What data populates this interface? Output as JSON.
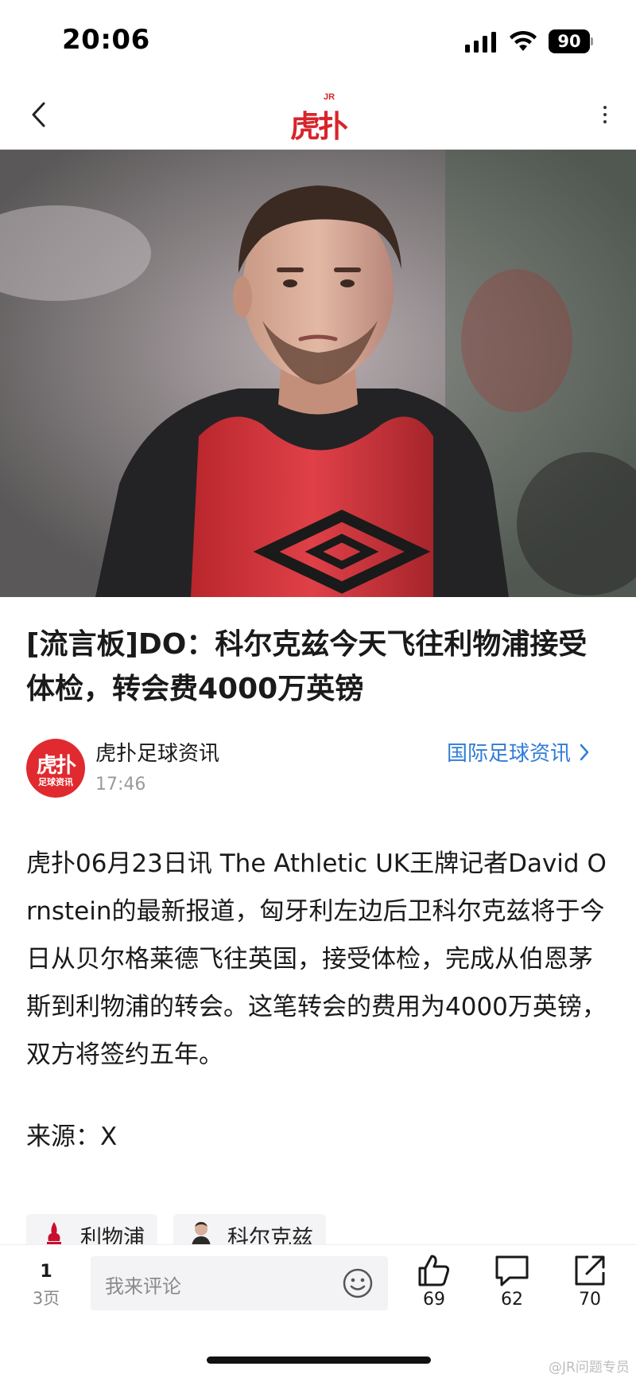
{
  "status_bar": {
    "time": "20:06",
    "battery": "90"
  },
  "nav": {
    "logo_small": "JR",
    "logo_main": "虎扑"
  },
  "article": {
    "title": "[流言板]DO：科尔克兹今天飞往利物浦接受体检，转会费4000万英镑",
    "author": {
      "name": "虎扑足球资讯",
      "avatar_main": "虎扑",
      "avatar_sub": "足球资讯",
      "time": "17:46"
    },
    "category": "国际足球资讯",
    "body": "虎扑06月23日讯 The Athletic UK王牌记者David Ornstein的最新报道，匈牙利左边后卫科尔克兹将于今日从贝尔格莱德飞往英国，接受体检，完成从伯恩茅斯到利物浦的转会。这笔转会的费用为4000万英镑，双方将签约五年。",
    "source": "来源：X",
    "tags": [
      {
        "label": "利物浦",
        "icon": "liverpool-crest-icon"
      },
      {
        "label": "科尔克兹",
        "icon": "player-avatar-icon"
      }
    ]
  },
  "bottom_bar": {
    "page_current": "1",
    "page_total": "3页",
    "comment_placeholder": "我来评论",
    "likes": "69",
    "comments": "62",
    "shares": "70",
    "watermark": "@JR问题专员"
  },
  "colors": {
    "brand_red": "#d8242c",
    "link_blue": "#2f7cd8",
    "bib_red": "#d6383f"
  }
}
